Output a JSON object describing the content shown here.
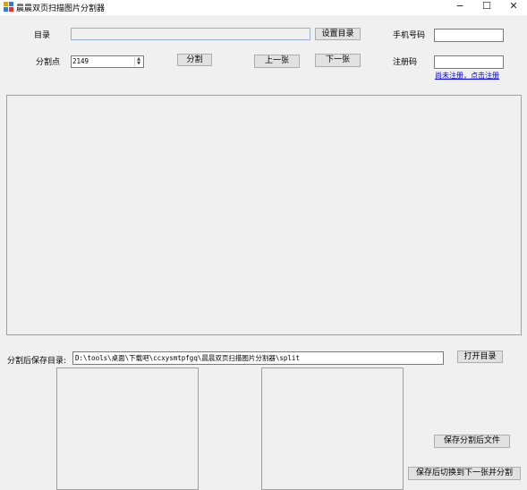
{
  "window": {
    "title": "晨晨双页扫描图片分割器",
    "minimize": "−",
    "maximize": "☐",
    "close": "✕"
  },
  "top": {
    "dir_label": "目录",
    "dir_value": "",
    "set_dir_button": "设置目录",
    "phone_label": "手机号码",
    "phone_value": "",
    "split_point_label": "分割点",
    "split_point_value": "2149",
    "split_button": "分割",
    "prev_button": "上一张",
    "next_button": "下一张",
    "reg_label": "注册码",
    "reg_value": "",
    "reg_link": "尚未注册，点击注册"
  },
  "bottom": {
    "save_dir_label": "分割后保存目录:",
    "save_dir_value": "D:\\tools\\桌面\\下载吧\\ccxysmtpfgq\\晨晨双页扫描图片分割器\\split",
    "open_dir_button": "打开目录",
    "save_split_button": "保存分割后文件",
    "save_next_button": "保存后切换到下一张并分割"
  },
  "colors": {
    "background": "#f0f0f0",
    "link": "#0000ee",
    "button_face": "#e1e1e1"
  }
}
